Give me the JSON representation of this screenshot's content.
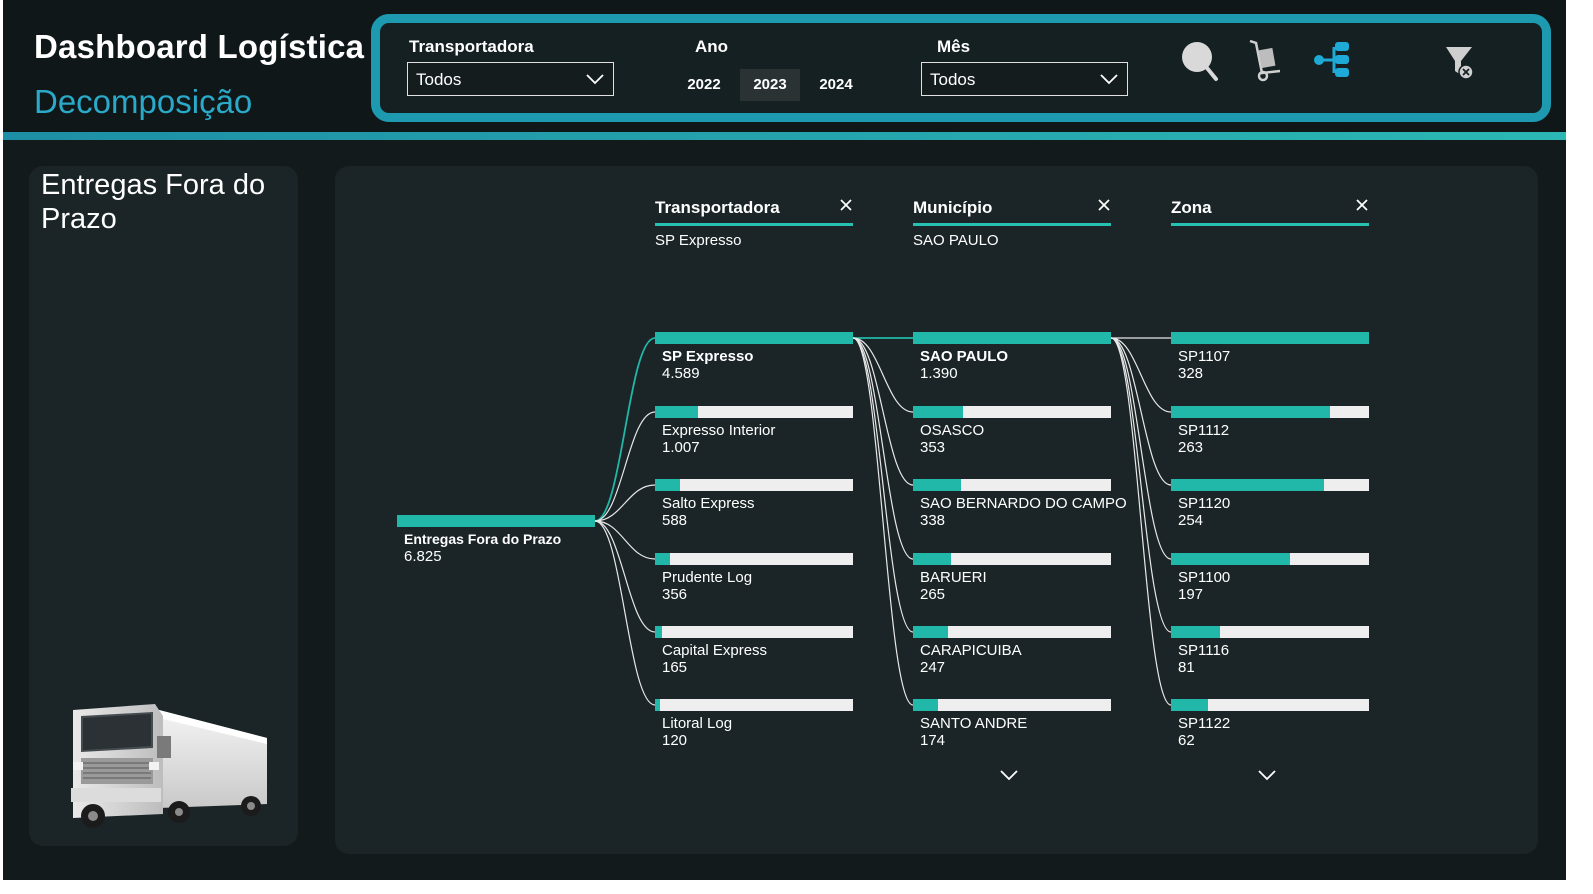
{
  "header": {
    "title": "Dashboard Logística",
    "subtitle": "Decomposição"
  },
  "filters": {
    "transportadora": {
      "label": "Transportadora",
      "value": "Todos"
    },
    "ano": {
      "label": "Ano",
      "options": [
        "2022",
        "2023",
        "2024"
      ],
      "selected": "2023"
    },
    "mes": {
      "label": "Mês",
      "value": "Todos"
    },
    "icons": [
      "search-icon",
      "hand-truck-icon",
      "decomposition-tree-icon",
      "clear-filter-icon"
    ]
  },
  "left_card": {
    "title": "Entregas Fora do Prazo",
    "image": "truck-image"
  },
  "tree": {
    "columns": [
      {
        "label": "Transportadora",
        "selected": "SP Expresso"
      },
      {
        "label": "Município",
        "selected": "SAO PAULO"
      },
      {
        "label": "Zona",
        "selected": ""
      }
    ],
    "root": {
      "label": "Entregas Fora do Prazo",
      "value": "6.825",
      "raw": 6825
    },
    "levels": [
      {
        "nodes": [
          {
            "label": "SP Expresso",
            "value": "4.589",
            "raw": 4589,
            "active": true
          },
          {
            "label": "Expresso Interior",
            "value": "1.007",
            "raw": 1007
          },
          {
            "label": "Salto Express",
            "value": "588",
            "raw": 588
          },
          {
            "label": "Prudente Log",
            "value": "356",
            "raw": 356
          },
          {
            "label": "Capital Express",
            "value": "165",
            "raw": 165
          },
          {
            "label": "Litoral Log",
            "value": "120",
            "raw": 120
          }
        ]
      },
      {
        "nodes": [
          {
            "label": "SAO PAULO",
            "value": "1.390",
            "raw": 1390,
            "active": true
          },
          {
            "label": "OSASCO",
            "value": "353",
            "raw": 353
          },
          {
            "label": "SAO BERNARDO DO CAMPO",
            "value": "338",
            "raw": 338
          },
          {
            "label": "BARUERI",
            "value": "265",
            "raw": 265
          },
          {
            "label": "CARAPICUIBA",
            "value": "247",
            "raw": 247
          },
          {
            "label": "SANTO ANDRE",
            "value": "174",
            "raw": 174
          }
        ]
      },
      {
        "nodes": [
          {
            "label": "SP1107",
            "value": "328",
            "raw": 328
          },
          {
            "label": "SP1112",
            "value": "263",
            "raw": 263
          },
          {
            "label": "SP1120",
            "value": "254",
            "raw": 254
          },
          {
            "label": "SP1100",
            "value": "197",
            "raw": 197
          },
          {
            "label": "SP1116",
            "value": "81",
            "raw": 81
          },
          {
            "label": "SP1122",
            "value": "62",
            "raw": 62
          }
        ]
      }
    ]
  },
  "colors": {
    "background": "#121a1c",
    "card": "#1b2527",
    "accent": "#21b8aa",
    "frame": "#1d9ab0",
    "subtitle": "#2aa9c8"
  }
}
